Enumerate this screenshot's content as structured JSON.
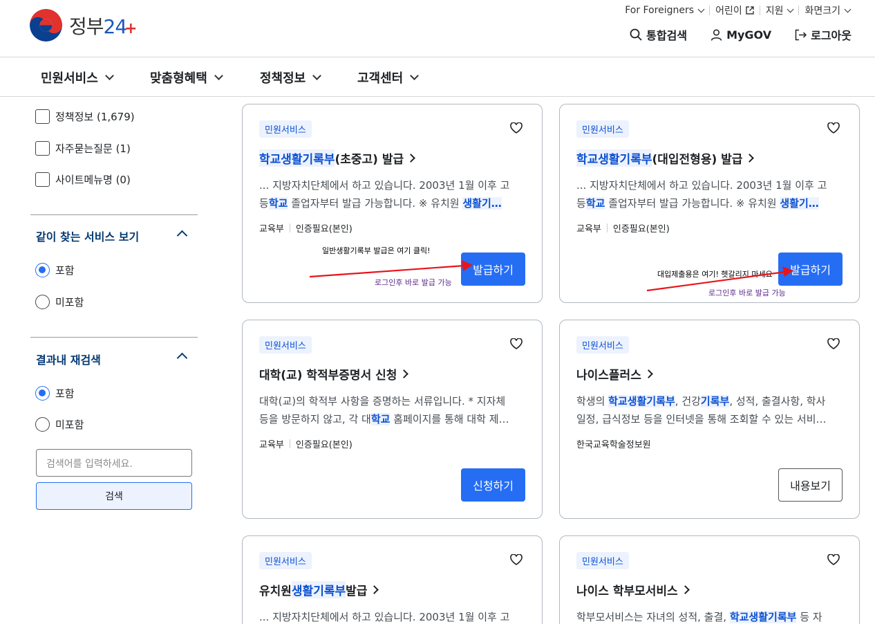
{
  "header": {
    "logo_text": "정부",
    "logo_num": "24",
    "utility": [
      {
        "label": "For Foreigners",
        "type": "dropdown"
      },
      {
        "label": "어린이",
        "type": "external"
      },
      {
        "label": "지원",
        "type": "dropdown"
      },
      {
        "label": "화면크기",
        "type": "dropdown"
      }
    ],
    "search_label": "통합검색",
    "mygov_label": "MyGOV",
    "logout_label": "로그아웃"
  },
  "gnb": [
    {
      "label": "민원서비스"
    },
    {
      "label": "맞춤형혜택"
    },
    {
      "label": "정책정보"
    },
    {
      "label": "고객센터"
    }
  ],
  "sidebar": {
    "filters": [
      {
        "label": "정책정보 (1,679)"
      },
      {
        "label": "자주묻는질문 (1)"
      },
      {
        "label": "사이트메뉴명 (0)"
      }
    ],
    "related": {
      "title": "같이 찾는 서비스 보기",
      "options": [
        "포함",
        "미포함"
      ]
    },
    "research": {
      "title": "결과내 재검색",
      "options": [
        "포함",
        "미포함"
      ],
      "placeholder": "검색어를 입력하세요.",
      "button": "검색"
    }
  },
  "cards": [
    {
      "badge": "민원서비스",
      "title_hl": "학교생활기록부",
      "title_rest": "(초중고) 발급",
      "desc1": "... 지방자치단체에서 하고 있습니다. 2003년 1월 이후 고",
      "desc2_a": "등",
      "desc2_hl": "학교",
      "desc2_b": " 졸업자부터 발급 가능합니다. ※ 유치원 ",
      "desc2_hl2": "생활기",
      "meta1": "교육부",
      "meta2": "인증필요(본인)",
      "button": "발급하기"
    },
    {
      "badge": "민원서비스",
      "title_hl": "학교생활기록부",
      "title_rest": "(대입전형용) 발급",
      "desc1": "... 지방자치단체에서 하고 있습니다. 2003년 1월 이후 고",
      "desc2_a": "등",
      "desc2_hl": "학교",
      "desc2_b": " 졸업자부터 발급 가능합니다. ※ 유치원 ",
      "desc2_hl2": "생활기",
      "meta1": "교육부",
      "meta2": "인증필요(본인)",
      "button": "발급하기"
    },
    {
      "badge": "민원서비스",
      "title": "대학(교) 학적부증명서 신청",
      "desc1": "대학(교)의 학적부 사항을 증명하는 서류입니다. * 지자체",
      "desc2_a": "등을 방문하지 않고, 각 대",
      "desc2_hl": "학교",
      "desc2_b": " 홈페이지를 통해 대학 제",
      "meta1": "교육부",
      "meta2": "인증필요(본인)",
      "button": "신청하기"
    },
    {
      "badge": "민원서비스",
      "title": "나이스플러스",
      "desc1_a": "학생의 ",
      "desc1_hl": "학교생활기록부",
      "desc1_b": ", 건강",
      "desc1_hl2": "기록부",
      "desc1_c": ", 성적, 출결사항, 학사",
      "desc2": "일정, 급식정보 등을 인터넷을 통해 조회할 수 있는 서비",
      "meta1": "한국교육학술정보원",
      "button": "내용보기"
    },
    {
      "badge": "민원서비스",
      "title_a": "유치원",
      "title_hl": "생활기록부",
      "title_rest": " 발급",
      "desc1": "... 지방자치단체에서 하고 있습니다. 2003년 1월 이후 고"
    },
    {
      "badge": "민원서비스",
      "title": "나이스 학부모서비스",
      "desc1_a": "학부모서비스는 자녀의 성적, 출결, ",
      "desc1_hl": "학교생활기록부",
      "desc1_b": " 등 자"
    }
  ],
  "annotations": {
    "a1": "일반생활기록부 발급은 여기 클릭!",
    "a1_sub": "로그인후 바로 발급 가능",
    "a2": "대입제출용은 여기! 헷갈리지 마세요",
    "a2_sub": "로그인후 바로 발급 가능",
    "arrow_color": "#e8141b"
  }
}
